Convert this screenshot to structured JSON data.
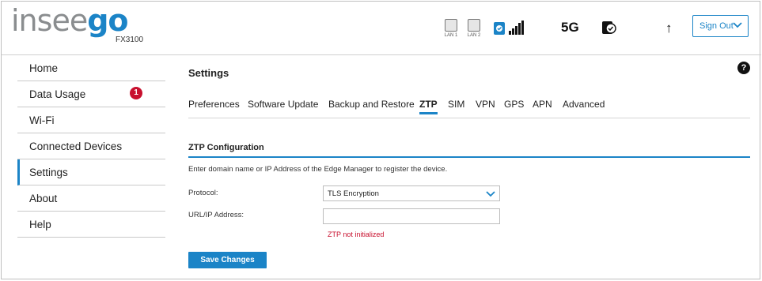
{
  "header": {
    "logo_gray": "insee",
    "logo_blue": "go",
    "model": "FX3100",
    "lan1_label": "LAN 1",
    "lan2_label": "LAN 2",
    "network_type": "5G",
    "upload_arrow": "↑",
    "sign_out_label": "Sign Out",
    "signal_bars": 5
  },
  "sidebar": {
    "items": [
      {
        "label": "Home"
      },
      {
        "label": "Data Usage"
      },
      {
        "label": "Wi-Fi"
      },
      {
        "label": "Connected Devices"
      },
      {
        "label": "Settings"
      },
      {
        "label": "About"
      },
      {
        "label": "Help"
      }
    ],
    "connected_devices_badge": "1"
  },
  "main": {
    "title": "Settings",
    "help_icon": "?",
    "tabs": [
      {
        "label": "Preferences"
      },
      {
        "label": "Software Update"
      },
      {
        "label": "Backup and Restore"
      },
      {
        "label": "ZTP"
      },
      {
        "label": "SIM"
      },
      {
        "label": "VPN"
      },
      {
        "label": "GPS"
      },
      {
        "label": "APN"
      },
      {
        "label": "Advanced"
      }
    ],
    "active_tab": "ZTP",
    "section_title": "ZTP Configuration",
    "description": "Enter domain name or IP Address of the Edge Manager to register the device.",
    "protocol_label": "Protocol:",
    "protocol_value": "TLS Encryption",
    "url_label": "URL/IP Address:",
    "url_value": "",
    "error_text": "ZTP not initialized",
    "save_label": "Save Changes"
  },
  "colors": {
    "accent": "#1b84c7",
    "error": "#c8102e",
    "logo_gray": "#8a8d8f"
  }
}
